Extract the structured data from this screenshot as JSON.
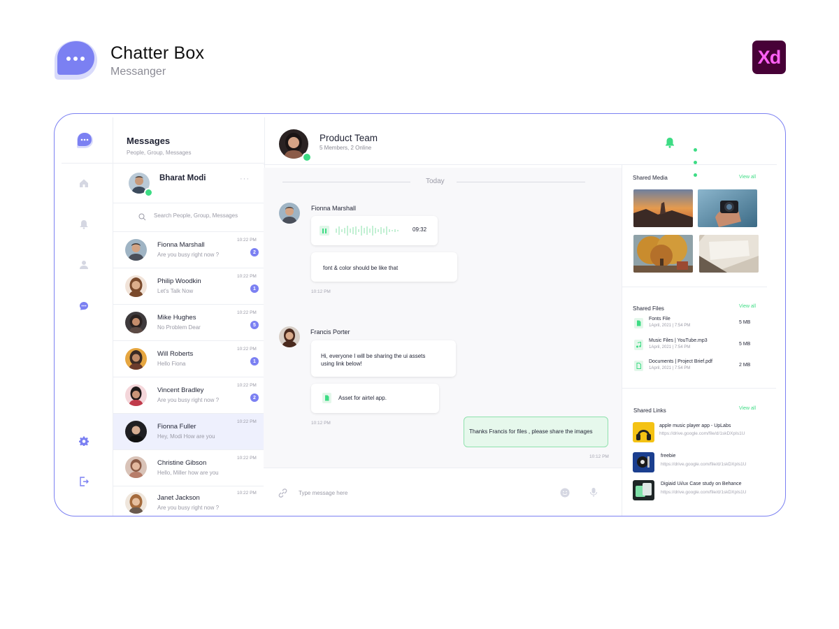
{
  "brand": {
    "title": "Chatter Box",
    "subtitle": "Messanger",
    "badge": "Xd"
  },
  "colors": {
    "accent": "#7b80f2",
    "online": "#3ddc84",
    "xd_bg": "#470137",
    "xd_fg": "#ff61f6"
  },
  "rail": {
    "icons": [
      "chat-logo-icon",
      "home-icon",
      "bell-icon",
      "user-icon",
      "chat-icon",
      "gear-icon",
      "logout-icon"
    ]
  },
  "messages": {
    "title": "Messages",
    "subtitle": "People, Group, Messages",
    "me": {
      "name": "Bharat Modi",
      "menu": "···"
    },
    "search_placeholder": "Search People, Group, Messages",
    "conversations": [
      {
        "name": "Fionna Marshall",
        "preview": "Are you busy right now ?",
        "time": "10:22 PM",
        "unread": "2"
      },
      {
        "name": "Philip Woodkin",
        "preview": "Let's Talk Now",
        "time": "10:22 PM",
        "unread": "1"
      },
      {
        "name": "Mike Hughes",
        "preview": "No Problem Dear",
        "time": "10:22 PM",
        "unread": "5"
      },
      {
        "name": "Will Roberts",
        "preview": "Hello Fiona",
        "time": "10:22 PM",
        "unread": "1"
      },
      {
        "name": "Vincent Bradley",
        "preview": "Are you busy right now ?",
        "time": "10:22 PM",
        "unread": "2"
      },
      {
        "name": "Fionna Fuller",
        "preview": "Hey, Modi How are you",
        "time": "10:22 PM",
        "unread": ""
      },
      {
        "name": "Christine Gibson",
        "preview": "Hello, Miller how are you",
        "time": "10:22 PM",
        "unread": ""
      },
      {
        "name": "Janet Jackson",
        "preview": "Are you busy right now ?",
        "time": "10:22 PM",
        "unread": ""
      }
    ]
  },
  "chat": {
    "title": "Product Team",
    "subtitle": "5 Members,  2 Online",
    "date_divider": "Today",
    "messages": [
      {
        "sender": "Fionna Marshall",
        "voice_duration": "09:32",
        "text": "font & color should be like that",
        "time": "10:12 PM"
      },
      {
        "sender": "Francis Porter",
        "text": "Hi, everyone I will be sharing the ui assets using link below!",
        "attachment": "Asset for airtel app.",
        "time": "10:12 PM"
      },
      {
        "sender": "me",
        "text": "Thanks Francis for files , please share the images",
        "time": "10:12 PM"
      }
    ],
    "input_placeholder": "Type message here"
  },
  "side": {
    "media": {
      "title": "Shared Media",
      "view_all": "View all",
      "items": [
        "sunset-coast-photo",
        "camera-hand-photo",
        "autumn-tree-photo",
        "books-photo"
      ]
    },
    "files": {
      "title": "Shared Files",
      "view_all": "View all",
      "items": [
        {
          "name": "Fonts File",
          "date": "1April, 2021 | 7:54 PM",
          "size": "5 MB",
          "icon": "file-icon"
        },
        {
          "name": "Music Files | YouTube.mp3",
          "date": "1April, 2021 | 7:54 PM",
          "size": "5 MB",
          "icon": "music-file-icon"
        },
        {
          "name": "Documents | Project Brief.pdf",
          "date": "1April, 2021 | 7:54 PM",
          "size": "2 MB",
          "icon": "document-icon"
        }
      ]
    },
    "links": {
      "title": "Shared Links",
      "view_all": "View all",
      "items": [
        {
          "title": "apple music player app - UpLabs",
          "url": "https://drive.google.com/file/d/1skDXpIs1U"
        },
        {
          "title": "freebie",
          "url": "https://drive.google.com/file/d/1skDXpIs1U"
        },
        {
          "title": "Digiaid Ui/ux Case study on Behance",
          "url": "https://drive.google.com/file/d/1skDXpIs1U"
        }
      ]
    }
  }
}
